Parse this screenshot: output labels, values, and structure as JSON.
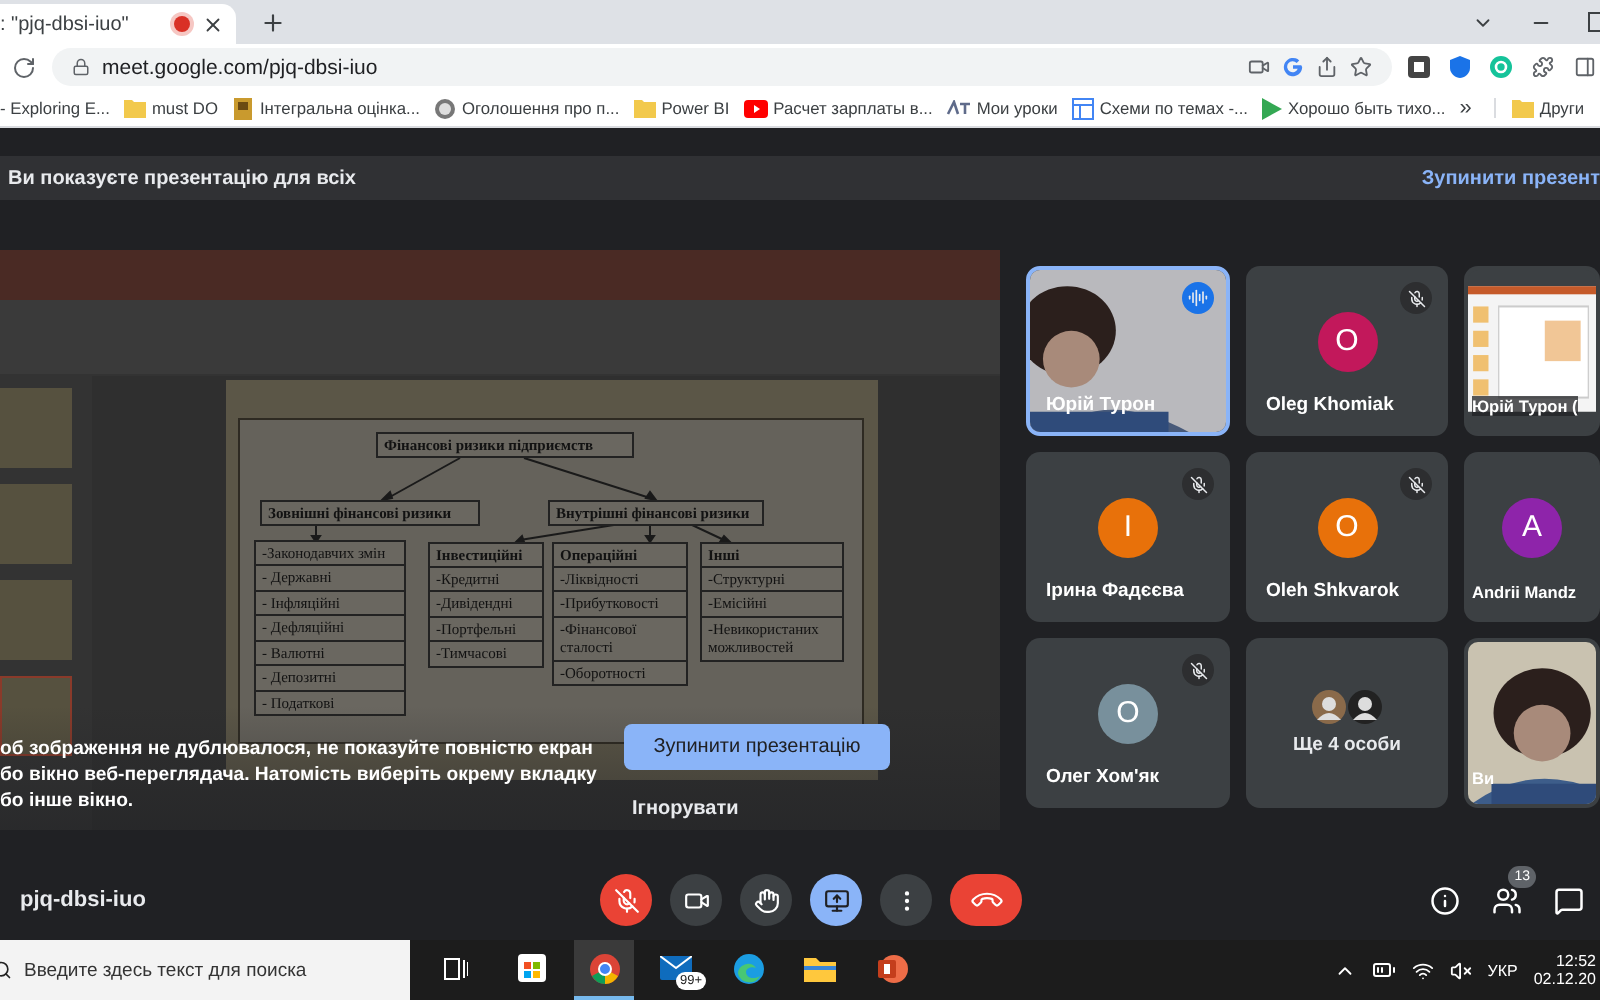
{
  "browser": {
    "tab": {
      "title": ": \"pjq-dbsi-iuo\"",
      "recording": true
    },
    "url": "meet.google.com/pjq-dbsi-iuo",
    "bookmarks": [
      "- Exploring E...",
      "must DO",
      "Інтегральна оцінка...",
      "Оголошення про п...",
      "Power BI",
      "Расчет зарплаты в...",
      "Мои уроки",
      "Схеми по темах -...",
      "Хорошо быть тихо..."
    ],
    "overflow": "»",
    "other_bookmarks": "Други"
  },
  "banner": {
    "message": "Ви показуєте презентацію для всіх",
    "action": "Зупинити презент"
  },
  "presentation": {
    "diagram": {
      "root": "Фінансові ризики підприємств",
      "external": {
        "title": "Зовнішні фінансові ризики",
        "items": [
          "-Законодавчих змін",
          "- Державні",
          "- Інфляційні",
          "- Дефляційні",
          "- Валютні",
          "- Депозитні",
          "- Податкові"
        ]
      },
      "internal": {
        "title": "Внутрішні фінансові ризики",
        "groups": [
          {
            "title": "Інвестиційні",
            "items": [
              "-Кредитні",
              "-Дивідендні",
              "-Портфельні",
              "-Тимчасові"
            ]
          },
          {
            "title": "Операційні",
            "items": [
              "-Ліквідності",
              "-Прибутковості",
              "-Фінансової сталості",
              "-Оборотності"
            ]
          },
          {
            "title": "Інші",
            "items": [
              "-Структурні",
              "-Емісійні",
              "-Невикористаних можливостей"
            ]
          }
        ]
      }
    },
    "warning_lines": [
      "об зображення не дублювалося, не показуйте повністю екран",
      "бо вікно веб-переглядача. Натомість виберіть окрему вкладку",
      "бо інше вікно."
    ],
    "stop_button": "Зупинити презентацію",
    "ignore_button": "Ігнорувати"
  },
  "tiles": [
    {
      "kind": "video",
      "name": "Юрій Турон",
      "speaking": true,
      "muted": false
    },
    {
      "kind": "avatar",
      "name": "Oleg Khomiak",
      "initial": "O",
      "color": "#c2185b",
      "speaking": false,
      "muted": true
    },
    {
      "kind": "screen",
      "name": "Юрій Турон (",
      "speaking": false,
      "muted": false
    },
    {
      "kind": "avatar",
      "name": "Ірина Фадєєва",
      "initial": "I",
      "color": "#e8710a",
      "speaking": false,
      "muted": true
    },
    {
      "kind": "avatar",
      "name": "Oleh Shkvarok",
      "initial": "O",
      "color": "#e8710a",
      "speaking": false,
      "muted": true
    },
    {
      "kind": "avatar",
      "name": "Andrii Mandz",
      "initial": "A",
      "color": "#8e24aa",
      "speaking": false,
      "muted": false
    },
    {
      "kind": "avatar",
      "name": "Олег Хом'як",
      "initial": "O",
      "color": "#78909c",
      "speaking": false,
      "muted": true
    },
    {
      "kind": "more",
      "name": "Ще 4 особи",
      "speaking": false,
      "muted": false
    },
    {
      "kind": "video",
      "name": "Ви",
      "speaking": false,
      "muted": false
    }
  ],
  "bottom_bar": {
    "meeting_code": "pjq-dbsi-iuo",
    "mic_muted": true,
    "presenting": true,
    "participants_count": "13"
  },
  "taskbar": {
    "search_placeholder": "Введите здесь текст для поиска",
    "apps": [
      {
        "kind": "store",
        "active": false
      },
      {
        "kind": "chrome",
        "active": true
      },
      {
        "kind": "mail",
        "active": false,
        "badge": "99+"
      },
      {
        "kind": "edge",
        "active": false
      },
      {
        "kind": "explorer",
        "active": false
      },
      {
        "kind": "powerpoint",
        "active": false
      }
    ],
    "language": "УКР",
    "time": "12:52",
    "date": "02.12.20"
  }
}
